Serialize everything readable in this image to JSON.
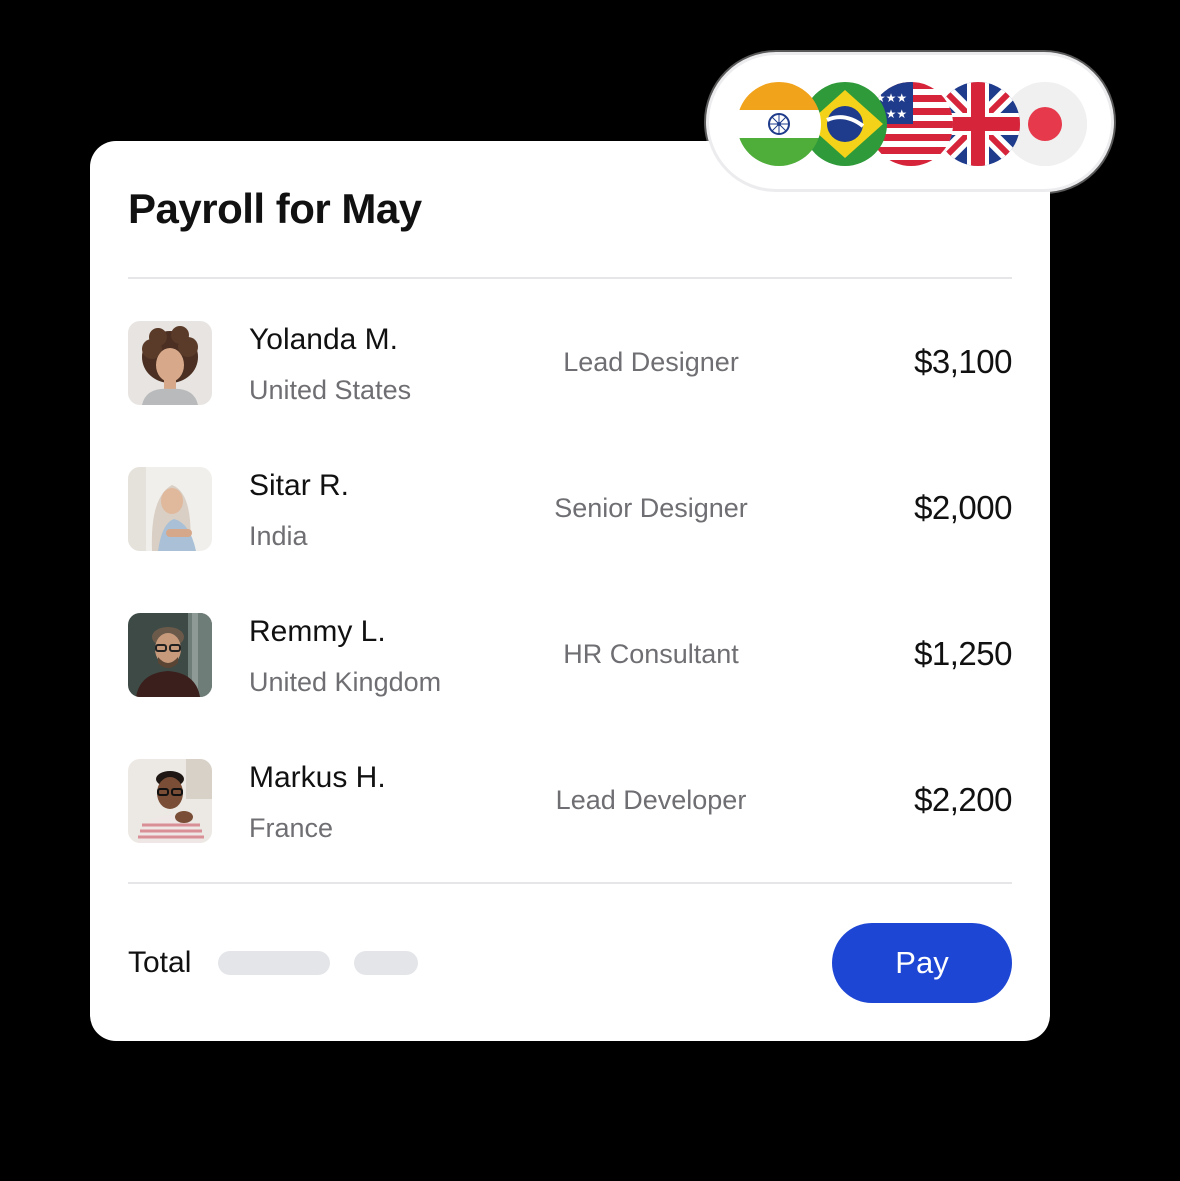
{
  "payroll": {
    "title": "Payroll for May",
    "employees": [
      {
        "name": "Yolanda M.",
        "country": "United States",
        "role": "Lead Designer",
        "amount": "$3,100"
      },
      {
        "name": "Sitar R.",
        "country": "India",
        "role": "Senior Designer",
        "amount": "$2,000"
      },
      {
        "name": "Remmy L.",
        "country": "United Kingdom",
        "role": "HR Consultant",
        "amount": "$1,250"
      },
      {
        "name": "Markus H.",
        "country": "France",
        "role": "Lead Developer",
        "amount": "$2,200"
      }
    ],
    "total_label": "Total",
    "pay_label": "Pay"
  },
  "flags": [
    "india-flag-icon",
    "brazil-flag-icon",
    "usa-flag-icon",
    "uk-flag-icon",
    "japan-flag-icon"
  ],
  "colors": {
    "background": "#000000",
    "card": "#ffffff",
    "accent": "#1d46d4",
    "muted_text": "#6f6f73"
  }
}
